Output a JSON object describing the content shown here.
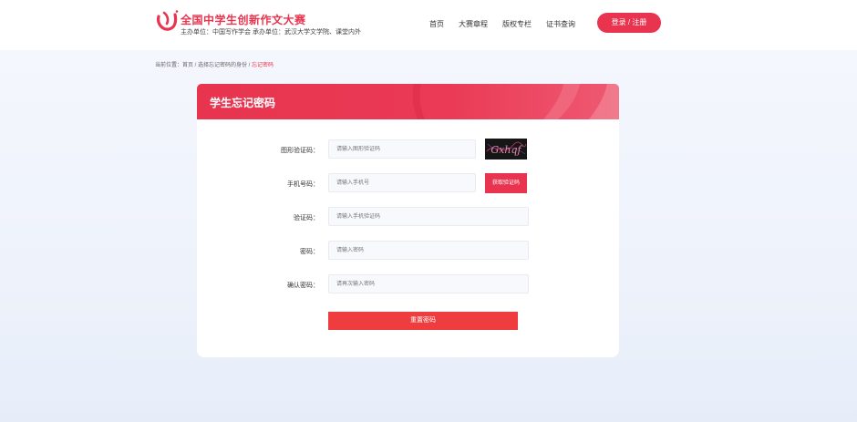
{
  "header": {
    "brand_title": "全国中学生创新作文大赛",
    "brand_sub": "主办单位：中国写作学会 承办单位：武汉大学文学院、课堂内外",
    "nav": [
      "首页",
      "大赛章程",
      "版权专栏",
      "证书查询"
    ],
    "login_label": "登录 / 注册"
  },
  "breadcrumb": {
    "prefix": "当前位置：",
    "path": "首页 / 选择忘记密码的身份 / ",
    "current": "忘记密码"
  },
  "card": {
    "title": "学生忘记密码"
  },
  "form": {
    "captcha_label": "图形验证码：",
    "captcha_placeholder": "请输入图形验证码",
    "captcha_text": "Gxhqf",
    "phone_label": "手机号码：",
    "phone_placeholder": "请输入手机号",
    "sms_button": "获取验证码",
    "code_label": "验证码：",
    "code_placeholder": "请输入手机验证码",
    "password_label": "密码：",
    "password_placeholder": "请输入密码",
    "confirm_label": "确认密码：",
    "confirm_placeholder": "请再次输入密码",
    "submit_label": "重置密码"
  },
  "colors": {
    "accent": "#e8344e",
    "submit": "#ef3d3f"
  },
  "icons": {
    "logo": "contest-logo-icon"
  }
}
